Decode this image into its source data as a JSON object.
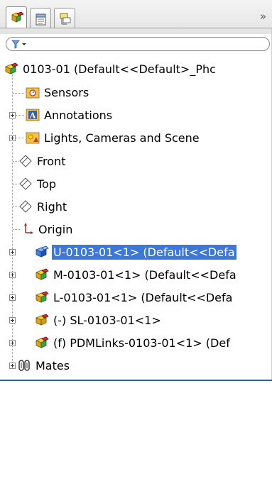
{
  "tabs": [
    {
      "name": "feature-manager-tab",
      "icon": "assembly-icon",
      "active": true
    },
    {
      "name": "property-manager-tab",
      "icon": "property-manager-icon",
      "active": false
    },
    {
      "name": "configuration-manager-tab",
      "icon": "configuration-manager-icon",
      "active": false
    }
  ],
  "expand_glyph": "»",
  "filter": {
    "icon": "filter-icon"
  },
  "tree": {
    "root": "0103-01  (Default<<Default>_Phc",
    "sensors": "Sensors",
    "annotations": "Annotations",
    "lights": "Lights, Cameras and Scene",
    "front": "Front",
    "top": "Top",
    "right": "Right",
    "origin": "Origin",
    "u_part": "U-0103-01<1> (Default<<Defa",
    "m_part": "M-0103-01<1> (Default<<Defa",
    "l_part": "L-0103-01<1> (Default<<Defa",
    "sl_part": "(-) SL-0103-01<1>",
    "pdm_part": "(f) PDMLinks-0103-01<1> (Def",
    "mates": "Mates"
  },
  "colors": {
    "selection": "#3c78d8",
    "separator": "#2f5fa8"
  }
}
